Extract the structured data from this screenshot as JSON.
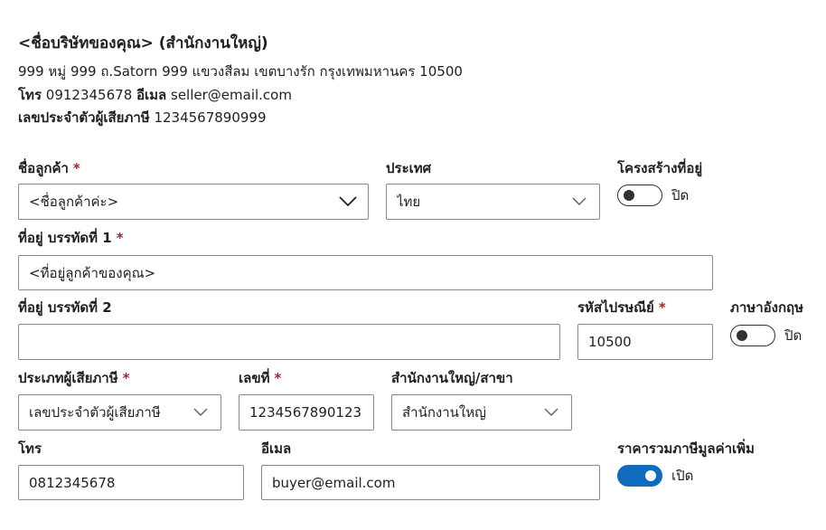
{
  "seller": {
    "name": "<ชื่อบริษัทของคุณ> (สำนักงานใหญ่)",
    "address": "999 หมู่ 999 ถ.Satorn 999 แขวงสีลม เขตบางรัก กรุงเทพมหานคร 10500",
    "phone_label": "โทร",
    "phone": "0912345678",
    "email_label": "อีเมล",
    "email": "seller@email.com",
    "tax_label": "เลขประจำตัวผู้เสียภาษี",
    "tax_id": "1234567890999"
  },
  "form": {
    "required_mark": "*",
    "customer": {
      "label": "ชื่อลูกค้า",
      "value": "<ชื่อลูกค้าค่ะ>"
    },
    "country": {
      "label": "ประเทศ",
      "value": "ไทย"
    },
    "address_structure": {
      "label": "โครงสร้างที่อยู่",
      "state": "ปิด",
      "on": false
    },
    "address1": {
      "label": "ที่อยู่ บรรทัดที่ 1",
      "value": "<ที่อยู่ลูกค้าของคุณ>"
    },
    "address2": {
      "label": "ที่อยู่ บรรทัดที่ 2",
      "value": ""
    },
    "postal": {
      "label": "รหัสไปรษณีย์",
      "value": "10500"
    },
    "english": {
      "label": "ภาษาอังกฤษ",
      "state": "ปิด",
      "on": false
    },
    "taxpayer_type": {
      "label": "ประเภทผู้เสียภาษี",
      "value": "เลขประจำตัวผู้เสียภาษี"
    },
    "tax_number": {
      "label": "เลขที่",
      "value": "1234567890123"
    },
    "branch": {
      "label": "สำนักงานใหญ่/สาขา",
      "value": "สำนักงานใหญ่"
    },
    "phone": {
      "label": "โทร",
      "value": "0812345678"
    },
    "email": {
      "label": "อีเมล",
      "value": "buyer@email.com"
    },
    "vat_included": {
      "label": "ราคารวมภาษีมูลค่าเพิ่ม",
      "state": "เปิด",
      "on": true
    }
  }
}
